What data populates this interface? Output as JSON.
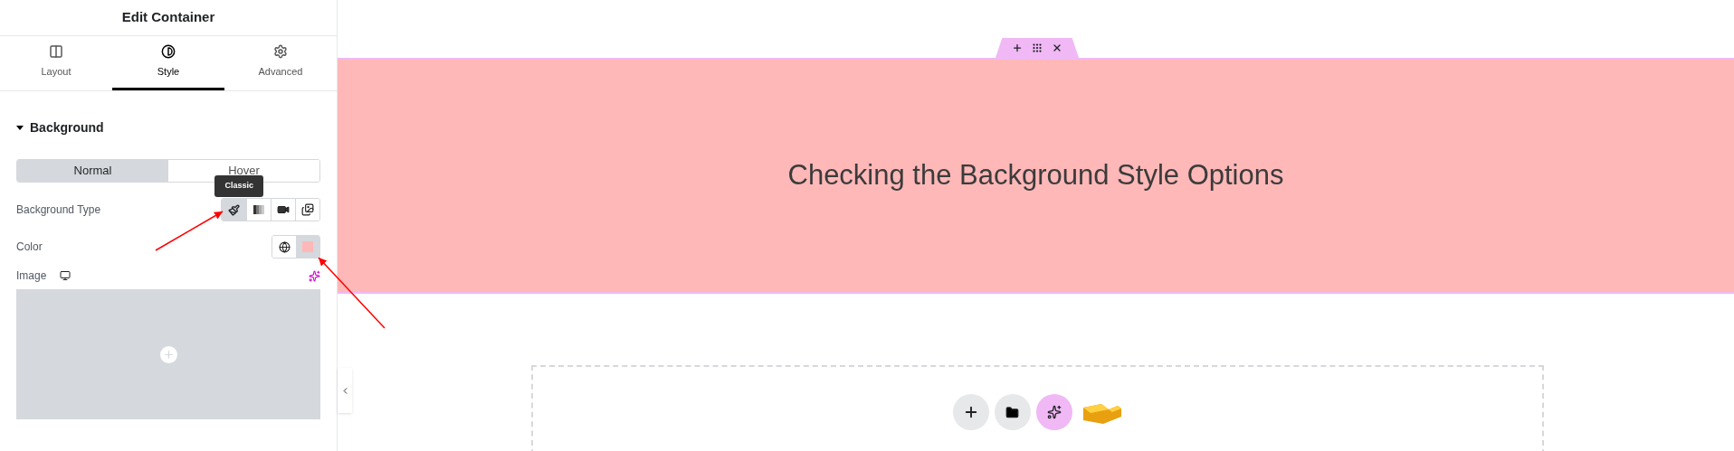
{
  "panel": {
    "title": "Edit Container",
    "tabs": [
      {
        "label": "Layout",
        "kind": "layout",
        "selected": false
      },
      {
        "label": "Style",
        "kind": "style",
        "selected": true
      },
      {
        "label": "Advanced",
        "kind": "advanced",
        "selected": false
      }
    ],
    "section": {
      "title": "Background",
      "expanded": true
    },
    "state_toggle": [
      {
        "label": "Normal",
        "selected": true
      },
      {
        "label": "Hover",
        "selected": false
      }
    ],
    "background_type": {
      "label": "Background Type",
      "tooltip": "Classic",
      "options": [
        {
          "kind": "classic",
          "selected": true
        },
        {
          "kind": "gradient",
          "selected": false
        },
        {
          "kind": "video",
          "selected": false
        },
        {
          "kind": "slideshow",
          "selected": false
        }
      ]
    },
    "color": {
      "label": "Color",
      "color": "#ffb8b8"
    },
    "image": {
      "label": "Image"
    }
  },
  "canvas": {
    "heading": "Checking the Background Style Options"
  }
}
